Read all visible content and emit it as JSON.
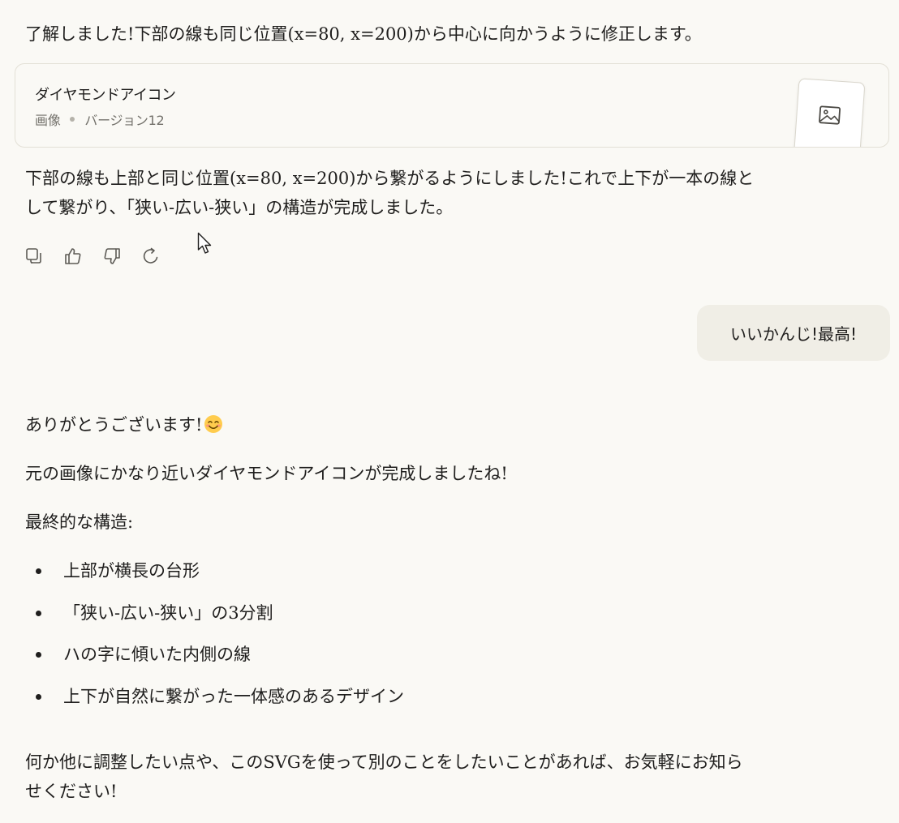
{
  "messages": {
    "intro": "了解しました!下部の線も同じ位置(x=80, x=200)から中心に向かうように修正します。",
    "artifact": {
      "title": "ダイヤモンドアイコン",
      "type": "画像",
      "version": "バージョン12",
      "icon": "image-icon"
    },
    "after_line1": "下部の線も上部と同じ位置(x=80, x=200)から繋がるようにしました!これで上下が一本の線と",
    "after_line2": "して繋がり、「狭い-広い-狭い」の構造が完成しました。",
    "actions": [
      {
        "icon": "copy-icon"
      },
      {
        "icon": "thumbs-up-icon"
      },
      {
        "icon": "thumbs-down-icon"
      },
      {
        "icon": "retry-icon"
      }
    ],
    "user_message": "いいかんじ!最高!",
    "reply": {
      "thanks": "ありがとうございます!",
      "emoji": "smiling-face-emoji",
      "line2": "元の画像にかなり近いダイヤモンドアイコンが完成しましたね!",
      "structure_heading": "最終的な構造:",
      "bullets": [
        "上部が横長の台形",
        "「狭い-広い-狭い」の3分割",
        "ハの字に傾いた内側の線",
        "上下が自然に繋がった一体感のあるデザイン"
      ],
      "closing_line1": "何か他に調整したい点や、このSVGを使って別のことをしたいことがあれば、お気軽にお知ら",
      "closing_line2": "せください!"
    }
  }
}
